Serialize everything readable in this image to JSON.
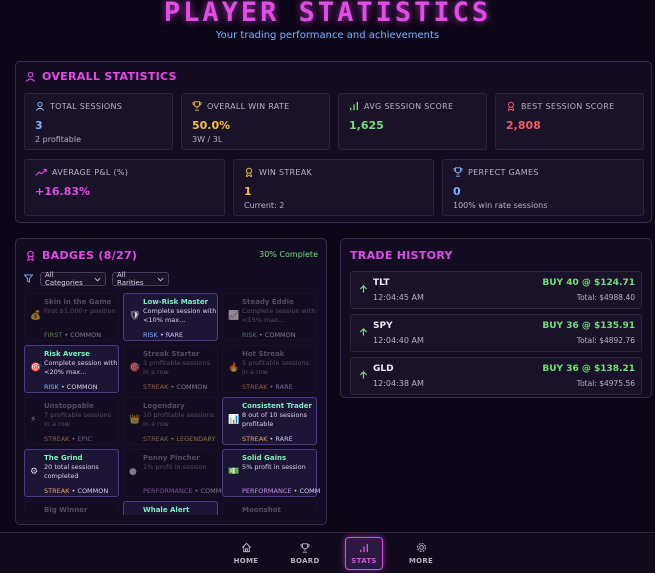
{
  "header": {
    "title": "PLAYER STATISTICS",
    "subtitle": "Your trading performance and achievements"
  },
  "overall": {
    "heading": "OVERALL STATISTICS",
    "cards": [
      {
        "label": "TOTAL SESSIONS",
        "value": "3",
        "sub": "2 profitable",
        "color": "#7fb3ff",
        "icon": "user-icon"
      },
      {
        "label": "OVERALL WIN RATE",
        "value": "50.0%",
        "sub": "3W / 3L",
        "color": "#f0c23b",
        "icon": "trophy-icon"
      },
      {
        "label": "AVG SESSION SCORE",
        "value": "1,625",
        "sub": "",
        "color": "#6fe07a",
        "icon": "bar-chart-icon"
      },
      {
        "label": "BEST SESSION SCORE",
        "value": "2,808",
        "sub": "",
        "color": "#f05b6b",
        "icon": "award-icon"
      },
      {
        "label": "AVERAGE P&L (%)",
        "value": "+16.83%",
        "sub": "",
        "color": "#e24ce6",
        "icon": "trend-up-icon"
      },
      {
        "label": "WIN STREAK",
        "value": "1",
        "sub": "Current: 2",
        "color": "#f0c23b",
        "icon": "medal-icon"
      },
      {
        "label": "PERFECT GAMES",
        "value": "0",
        "sub": "100% win rate sessions",
        "color": "#7fb3ff",
        "icon": "trophy-icon"
      }
    ]
  },
  "badges": {
    "heading": "BADGES (8/27)",
    "progress": "30% Complete",
    "filters": {
      "category": "All Categories",
      "rarity": "All Rarities"
    },
    "items": [
      {
        "name": "Skin in the Game",
        "desc": "First $1,000+ position",
        "cat": "FIRST",
        "rarity": "COMMON",
        "icon": "💰",
        "unlocked": false
      },
      {
        "name": "Low-Risk Master",
        "desc": "Complete session with <10% max...",
        "cat": "RISK",
        "rarity": "RARE",
        "icon": "🛡",
        "unlocked": true
      },
      {
        "name": "Steady Eddie",
        "desc": "Complete session with <15% max...",
        "cat": "RISK",
        "rarity": "COMMON",
        "icon": "📈",
        "unlocked": false
      },
      {
        "name": "Risk Averse",
        "desc": "Complete session with <20% max...",
        "cat": "RISK",
        "rarity": "COMMON",
        "icon": "🎯",
        "unlocked": true
      },
      {
        "name": "Streak Starter",
        "desc": "3 profitable sessions in a row",
        "cat": "STREAK",
        "rarity": "COMMON",
        "icon": "🎯",
        "unlocked": false
      },
      {
        "name": "Hot Streak",
        "desc": "5 profitable sessions in a row",
        "cat": "STREAK",
        "rarity": "RARE",
        "icon": "🔥",
        "unlocked": false
      },
      {
        "name": "Unstoppable",
        "desc": "7 profitable sessions in a row",
        "cat": "STREAK",
        "rarity": "EPIC",
        "icon": "⚡",
        "unlocked": false
      },
      {
        "name": "Legendary",
        "desc": "10 profitable sessions in a row",
        "cat": "STREAK",
        "rarity": "LEGENDARY",
        "icon": "👑",
        "unlocked": false
      },
      {
        "name": "Consistent Trader",
        "desc": "8 out of 10 sessions profitable",
        "cat": "STREAK",
        "rarity": "RARE",
        "icon": "📊",
        "unlocked": true
      },
      {
        "name": "The Grind",
        "desc": "20 total sessions completed",
        "cat": "STREAK",
        "rarity": "COMMON",
        "icon": "⚙",
        "unlocked": true
      },
      {
        "name": "Penny Pincher",
        "desc": "1% profit in session",
        "cat": "PERFORMANCE",
        "rarity": "COMMON",
        "icon": "●",
        "unlocked": false
      },
      {
        "name": "Solid Gains",
        "desc": "5% profit in session",
        "cat": "PERFORMANCE",
        "rarity": "COMMON",
        "icon": "💵",
        "unlocked": true
      },
      {
        "name": "Big Winner",
        "desc": "",
        "cat": "",
        "rarity": "",
        "icon": "",
        "unlocked": false
      },
      {
        "name": "Whale Alert",
        "desc": "",
        "cat": "",
        "rarity": "",
        "icon": "",
        "unlocked": true
      },
      {
        "name": "Moonshot",
        "desc": "",
        "cat": "",
        "rarity": "",
        "icon": "",
        "unlocked": false
      }
    ]
  },
  "trades": {
    "heading": "TRADE HISTORY",
    "rows": [
      {
        "symbol": "TLT",
        "time": "12:04:45 AM",
        "action": "BUY 40 @ $124.71",
        "total": "Total: $4988.40"
      },
      {
        "symbol": "SPY",
        "time": "12:04:40 AM",
        "action": "BUY 36 @ $135.91",
        "total": "Total: $4892.76"
      },
      {
        "symbol": "GLD",
        "time": "12:04:38 AM",
        "action": "BUY 36 @ $138.21",
        "total": "Total: $4975.56"
      }
    ]
  },
  "nav": {
    "items": [
      {
        "label": "HOME",
        "icon": "home-icon"
      },
      {
        "label": "BOARD",
        "icon": "trophy-icon"
      },
      {
        "label": "STATS",
        "icon": "bar-chart-icon"
      },
      {
        "label": "MORE",
        "icon": "gear-icon"
      }
    ],
    "active": "STATS"
  },
  "colors": {
    "accent": "#e24ce6",
    "risk": "#7fb3ff",
    "streak": "#f0a050",
    "performance": "#c58cf0",
    "first": "#9ad07a",
    "rare": "#c8c0ff",
    "epic": "#d58cf0",
    "legendary": "#f0c23b",
    "common": "#d9d3e6"
  }
}
